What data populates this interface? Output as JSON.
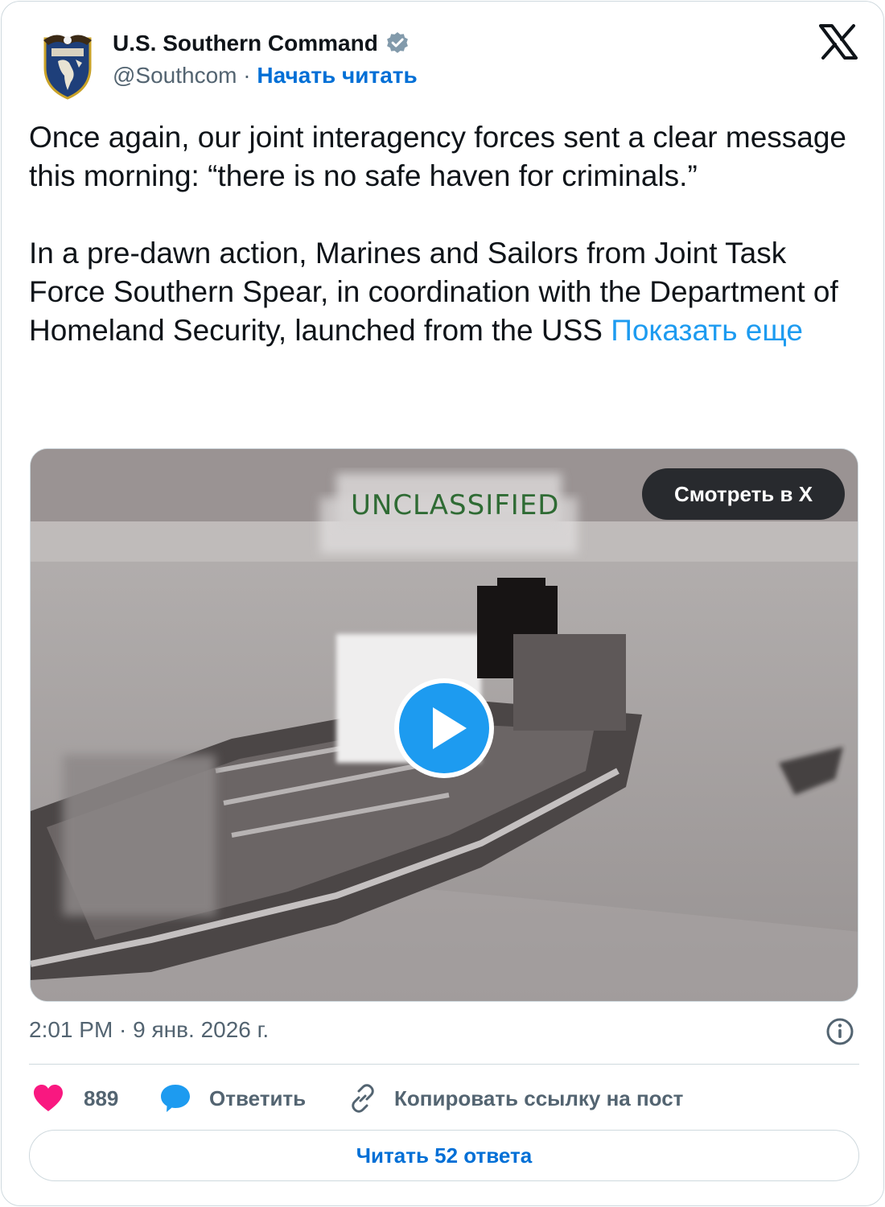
{
  "author": {
    "name": "U.S. Southern Command",
    "handle": "@Southcom",
    "separator": "·",
    "follow_label": "Начать читать",
    "verified": true,
    "avatar_icon": "southcom-seal-icon"
  },
  "tweet": {
    "paragraph_1": "Once again, our joint interagency forces sent a clear message this morning: “there is no safe haven for criminals.”",
    "paragraph_2": "In a pre-dawn action, Marines and Sailors from Joint Task Force Southern Spear, in coordination with the Department of Homeland Security, launched from the USS",
    "show_more_label": "Показать еще"
  },
  "media": {
    "overlay_text": "UNCLASSIFIED",
    "watch_label": "Смотреть в X",
    "play_icon": "play-icon"
  },
  "timestamp": "2:01 PM · 9 янв. 2026 г.",
  "actions": {
    "like_count": "889",
    "reply_label": "Ответить",
    "copy_link_label": "Копировать ссылку на пост"
  },
  "read_replies_label": "Читать 52 ответа",
  "colors": {
    "link_blue": "#1d9bf0",
    "follow_blue": "#006fd6",
    "like_pink": "#f91880",
    "muted_text": "#536471",
    "border": "#cfd9de"
  }
}
